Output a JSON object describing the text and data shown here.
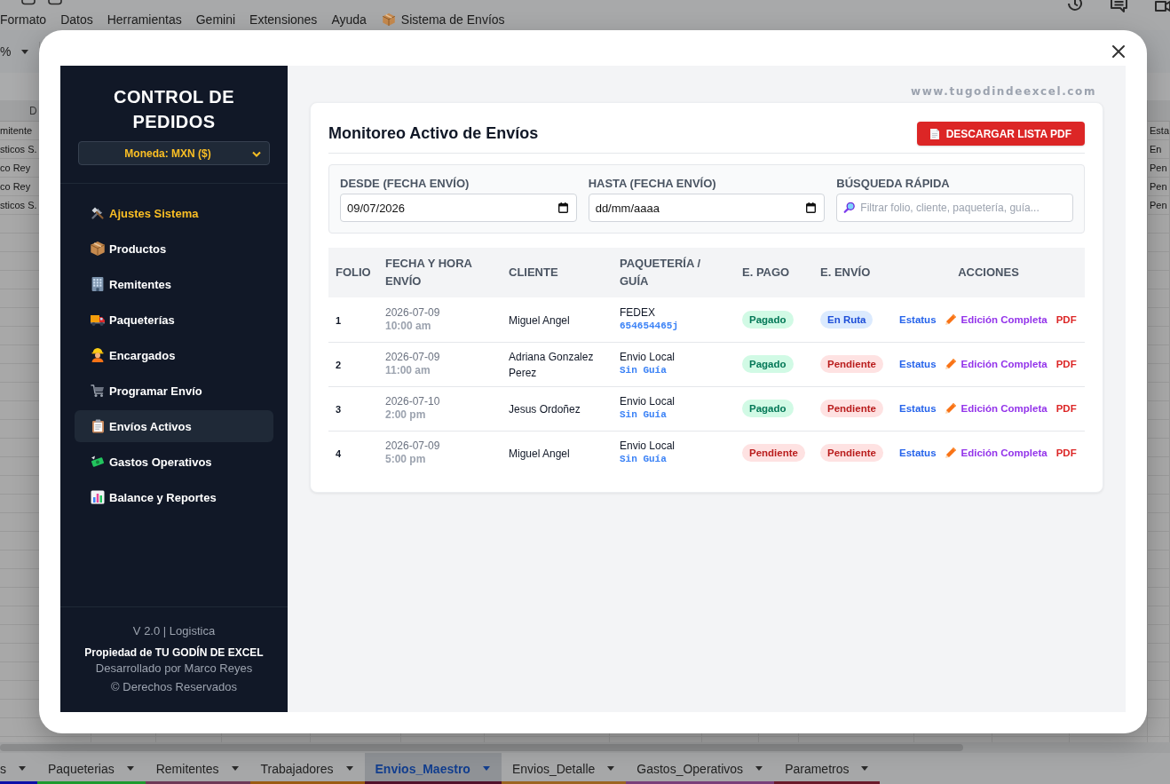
{
  "spreadsheet": {
    "menu": [
      {
        "label": "Formato",
        "kind": "menu"
      },
      {
        "label": "Datos",
        "kind": "menu"
      },
      {
        "label": "Herramientas",
        "kind": "menu"
      },
      {
        "label": "Gemini",
        "kind": "menu"
      },
      {
        "label": "Extensiones",
        "kind": "menu"
      },
      {
        "label": "Ayuda",
        "kind": "menu"
      },
      {
        "label": "Sistema de Envíos",
        "kind": "addon"
      }
    ],
    "toolbar_text": "%",
    "column_header": "D",
    "left_cells": [
      "mitente",
      "sticos S.",
      "co Rey",
      "co Rey",
      "sticos S."
    ],
    "right_cells": [
      "Esta",
      "En",
      "Pen",
      "Pen",
      "Pen"
    ],
    "sheet_tabs": [
      {
        "label": "s",
        "selected": false,
        "color": "#0b0fa8"
      },
      {
        "label": "Paqueterias",
        "selected": false,
        "color": "#1e9a2e"
      },
      {
        "label": "Remitentes",
        "selected": false,
        "color": "#6e3a57"
      },
      {
        "label": "Trabajadores",
        "selected": false,
        "color": "#9a5b12"
      },
      {
        "label": "Envios_Maestro",
        "selected": true,
        "color": "#52112a"
      },
      {
        "label": "Envios_Detalle",
        "selected": false,
        "color": "#9b6521"
      },
      {
        "label": "Gastos_Operativos",
        "selected": false,
        "color": "#7a3f7a"
      },
      {
        "label": "Parametros",
        "selected": false,
        "color": "#6a1a2a"
      }
    ]
  },
  "dialog": {
    "sidebar": {
      "title": "CONTROL DE PEDIDOS",
      "currency": "Moneda: MXN ($)",
      "items": [
        {
          "label": "Ajustes Sistema",
          "selected": false,
          "accent": true
        },
        {
          "label": "Productos",
          "selected": false,
          "accent": false
        },
        {
          "label": "Remitentes",
          "selected": false,
          "accent": false
        },
        {
          "label": "Paqueterías",
          "selected": false,
          "accent": false
        },
        {
          "label": "Encargados",
          "selected": false,
          "accent": false
        },
        {
          "label": "Programar Envío",
          "selected": false,
          "accent": false
        },
        {
          "label": "Envíos Activos",
          "selected": true,
          "accent": false
        },
        {
          "label": "Gastos Operativos",
          "selected": false,
          "accent": false
        },
        {
          "label": "Balance y Reportes",
          "selected": false,
          "accent": false
        }
      ],
      "footer": {
        "version": "V 2.0 | Logistica",
        "owner": "Propiedad de TU GODÍN DE EXCEL",
        "developer": "Desarrollado por Marco Reyes",
        "rights": "© Derechos Reservados"
      }
    },
    "site_url": "www.tugodindeexcel.com",
    "panel": {
      "title": "Monitoreo Activo de Envíos",
      "download_button": "DESCARGAR LISTA PDF",
      "filters": [
        {
          "kind": "date",
          "label": "DESDE (FECHA ENVÍO)",
          "value": "09/07/2026"
        },
        {
          "kind": "date",
          "label": "HASTA (FECHA ENVÍO)",
          "placeholder": "dd/mm/aaaa"
        },
        {
          "kind": "search",
          "label": "BÚSQUEDA RÁPIDA",
          "placeholder": "Filtrar folio, cliente, paquetería, guía..."
        }
      ],
      "table": {
        "columns": [
          "FOLIO",
          "FECHA Y HORA ENVÍO",
          "CLIENTE",
          "PAQUETERÍA / GUÍA",
          "E. PAGO",
          "E. ENVÍO",
          "ACCIONES"
        ],
        "rows": [
          {
            "folio": "1",
            "date": "2026-07-09",
            "time": "10:00 am",
            "client": "Miguel Angel",
            "carrier": "FEDEX",
            "tracking": "654654465j",
            "payment": {
              "label": "Pagado",
              "kind": "paid"
            },
            "shipping": {
              "label": "En Ruta",
              "kind": "in_transit"
            },
            "actions": {
              "status": "Estatus",
              "edit": "Edición Completa",
              "pdf": "PDF"
            }
          },
          {
            "folio": "2",
            "date": "2026-07-09",
            "time": "11:00 am",
            "client": "Adriana Gonzalez Perez",
            "carrier": "Envio Local",
            "tracking": "Sin Guía",
            "payment": {
              "label": "Pagado",
              "kind": "paid"
            },
            "shipping": {
              "label": "Pendiente",
              "kind": "pending"
            },
            "actions": {
              "status": "Estatus",
              "edit": "Edición Completa",
              "pdf": "PDF"
            }
          },
          {
            "folio": "3",
            "date": "2026-07-10",
            "time": "2:00 pm",
            "client": "Jesus Ordoñez",
            "carrier": "Envio Local",
            "tracking": "Sin Guía",
            "payment": {
              "label": "Pagado",
              "kind": "paid"
            },
            "shipping": {
              "label": "Pendiente",
              "kind": "pending"
            },
            "actions": {
              "status": "Estatus",
              "edit": "Edición Completa",
              "pdf": "PDF"
            }
          },
          {
            "folio": "4",
            "date": "2026-07-09",
            "time": "5:00 pm",
            "client": "Miguel Angel",
            "carrier": "Envio Local",
            "tracking": "Sin Guía",
            "payment": {
              "label": "Pendiente",
              "kind": "pending"
            },
            "shipping": {
              "label": "Pendiente",
              "kind": "pending"
            },
            "actions": {
              "status": "Estatus",
              "edit": "Edición Completa",
              "pdf": "PDF"
            }
          }
        ]
      }
    }
  }
}
